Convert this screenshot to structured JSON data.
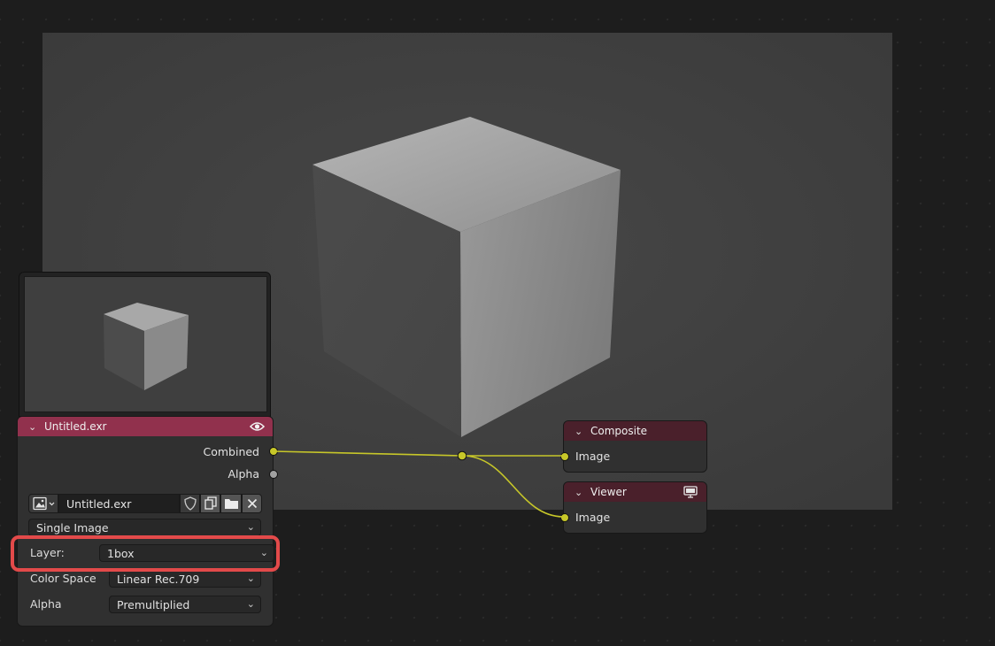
{
  "image_node": {
    "title": "Untitled.exr",
    "outputs": {
      "combined": "Combined",
      "alpha": "Alpha"
    },
    "image_name": "Untitled.exr",
    "source": "Single Image",
    "layer_label": "Layer:",
    "layer_value": "1box",
    "colorspace_label": "Color Space",
    "colorspace_value": "Linear Rec.709",
    "alpha_label": "Alpha",
    "alpha_value": "Premultiplied"
  },
  "composite_node": {
    "title": "Composite",
    "input": "Image"
  },
  "viewer_node": {
    "title": "Viewer",
    "input": "Image"
  },
  "colors": {
    "image_header": "#91314d",
    "output_header": "#4a202b",
    "link": "#c7c729",
    "highlight": "#e34a4a"
  }
}
